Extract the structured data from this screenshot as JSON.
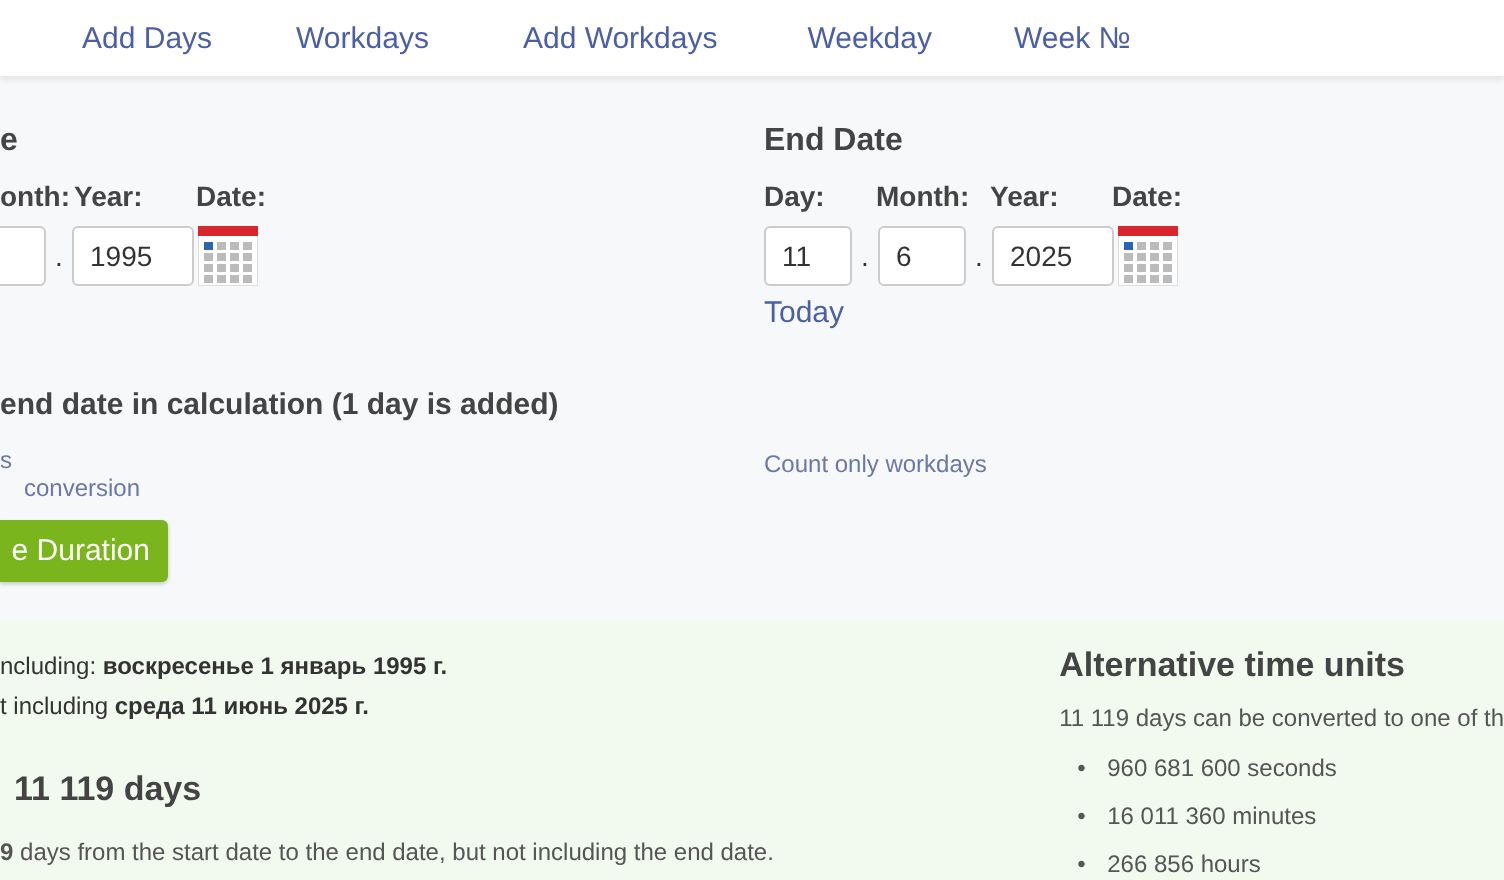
{
  "nav": {
    "tabs": [
      {
        "label": "Add Days",
        "selected": false
      },
      {
        "label": "Workdays",
        "selected": false
      },
      {
        "label": "Add Workdays",
        "selected": false
      },
      {
        "label": "Weekday",
        "selected": false
      },
      {
        "label": "Week №",
        "selected": false
      }
    ]
  },
  "start": {
    "title": "e",
    "labels": [
      "onth:",
      "Year:",
      "Date:"
    ],
    "separator": ".",
    "year": "1995"
  },
  "end": {
    "title": "End Date",
    "labels": [
      "Day:",
      "Month:",
      "Year:",
      "Date:"
    ],
    "day": "11",
    "separators": [
      ".",
      "."
    ],
    "month": "6",
    "year": "2025",
    "today": "Today"
  },
  "include_end": "end date in calculation (1 day is added)",
  "links_left": [
    "s",
    "conversion"
  ],
  "link_right": "Count only workdays",
  "calculate_button": "e Duration",
  "result": {
    "from": "ncluding: **воскресенье 1 январь 1995 г.**",
    "to": "t including **среда 11 июнь 2025 г.**",
    "heading": "11 119 days",
    "sentence": "**9** days from the start date to the end date, but not including the end date."
  },
  "alternative": {
    "title": "Alternative time units",
    "intro": "11 119 days can be converted to one of th",
    "bullet": "•",
    "items": [
      "960 681 600 seconds",
      "16 011 360 minutes",
      "266 856 hours"
    ]
  }
}
